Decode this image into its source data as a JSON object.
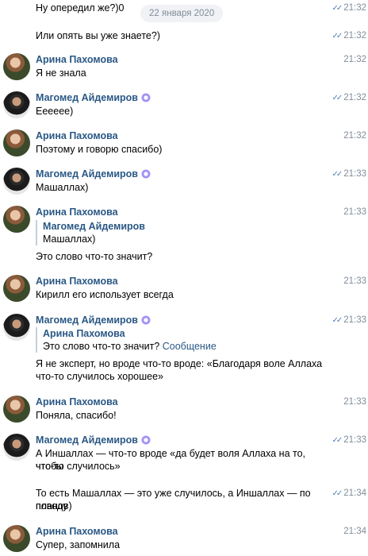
{
  "date_label": "22 января 2020",
  "colors": {
    "link": "#2a5885",
    "time": "#818c99",
    "ticks": "#5181b8",
    "quote_bar": "#c5d0db"
  },
  "messages": [
    {
      "text": "Ну опередил же?)0",
      "time": "21:32",
      "read": true
    },
    {
      "text": "Или опять вы уже знаете?)",
      "time": "21:32",
      "read": true
    },
    {
      "author": "Арина Пахомова",
      "text": "Я не знала",
      "time": "21:32",
      "read": false
    },
    {
      "author": "Магомед Айдемиров",
      "text": "Ееееее)",
      "time": "21:32",
      "read": true
    },
    {
      "author": "Арина Пахомова",
      "text": "Поэтому и говорю спасибо)",
      "time": "21:32",
      "read": false
    },
    {
      "author": "Магомед Айдемиров",
      "text": "Машаллах)",
      "time": "21:33",
      "read": true
    },
    {
      "author": "Арина Пахомова",
      "quote_author": "Магомед Айдемиров",
      "quote_text": "Машаллах)",
      "text": "Это слово что-то значит?",
      "time": "21:33",
      "read": false
    },
    {
      "author": "Арина Пахомова",
      "text": "Кирилл его использует всегда",
      "time": "21:33",
      "read": false
    },
    {
      "author": "Магомед Айдемиров",
      "quote_author": "Арина Пахомова",
      "quote_text": "Это слово что-то значит?",
      "quote_link": "Сообщение",
      "text_line1": "Я не эксперт, но вроде что-то вроде: «Благодаря воле Аллаха",
      "text_line2": "что-то случилось хорошее»",
      "time": "21:33",
      "read": true
    },
    {
      "author": "Арина Пахомова",
      "text": "Поняла, спасибо!",
      "time": "21:33",
      "read": false
    },
    {
      "author": "Магомед Айдемиров",
      "text_line1": "А Иншаллах — что-то вроде «да будет воля Аллаха на то, чтобы",
      "text_line2": "что-то случилось»",
      "time": "21:33",
      "read": true
    },
    {
      "text_line1": "То есть Машаллах — это уже случилось, а Иншаллах — по поводу",
      "text_line2": "планов)",
      "time": "21:34",
      "read": true
    },
    {
      "author": "Арина Пахомова",
      "text": "Супер, запомнила",
      "time": "21:34",
      "read": false
    }
  ]
}
